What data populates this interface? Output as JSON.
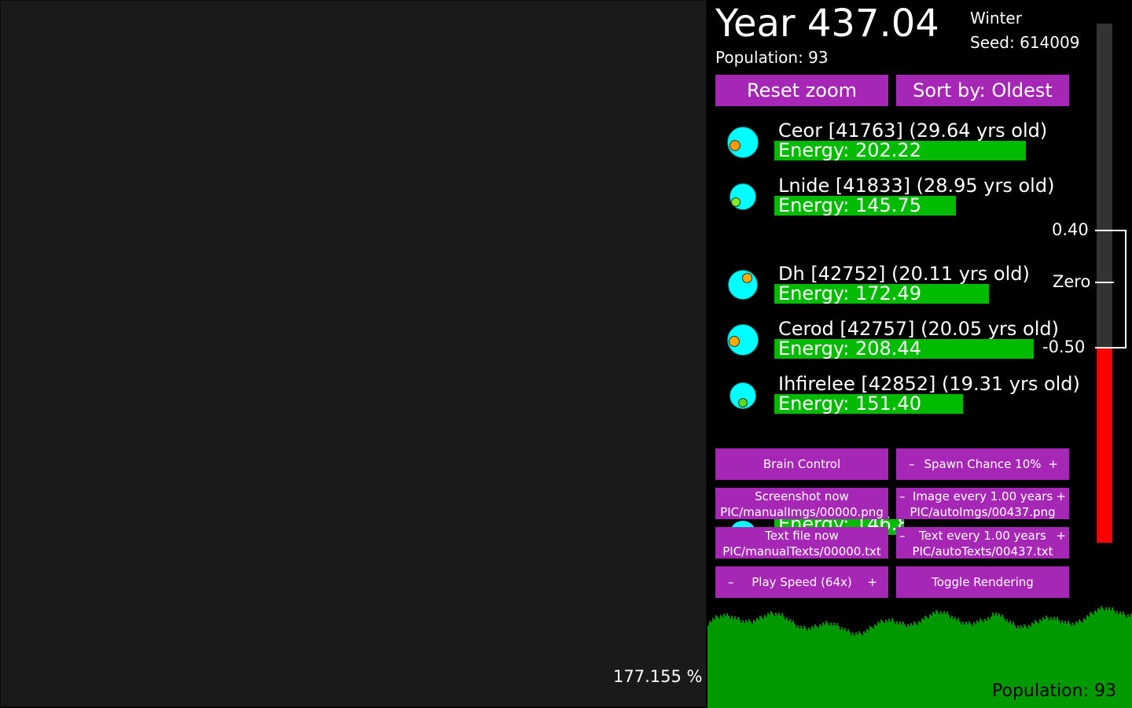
{
  "world": {
    "zoom_readout": "177.155 %"
  },
  "header": {
    "year": "Year 437.04",
    "population": "Population: 93",
    "season": "Winter",
    "seed": "Seed: 614009"
  },
  "buttons": {
    "reset_zoom": "Reset zoom",
    "sort_by": "Sort by: Oldest",
    "brain_control": "Brain Control",
    "spawn_chance": "Spawn Chance 10%",
    "screenshot_now": "Screenshot now",
    "screenshot_path": "PIC/manualImgs/00000.png",
    "image_every": "Image every 1.00 years",
    "image_path": "PIC/autoImgs/00437.png",
    "text_file_now": "Text file now",
    "text_file_path": "PIC/manualTexts/00000.txt",
    "text_every": "Text every 1.00 years",
    "text_path": "PIC/autoTexts/00437.txt",
    "play_speed": "Play Speed (64x)",
    "toggle_rendering": "Toggle Rendering",
    "minus": "–",
    "plus": "+"
  },
  "critters": [
    {
      "name": "Ceor [41763] (29.64 yrs old)",
      "energy_label": "Energy: 202.22",
      "energy": 202.22,
      "mouth_color": "#ff9900"
    },
    {
      "name": "Lnide [41833] (28.95 yrs old)",
      "energy_label": "Energy: 145.75",
      "energy": 145.75,
      "mouth_color": "#88ee22"
    },
    {
      "name": "Dh [42752] (20.11 yrs old)",
      "energy_label": "Energy: 172.49",
      "energy": 172.49,
      "mouth_color": "#ffaa00"
    },
    {
      "name": "Cerod [42757] (20.05 yrs old)",
      "energy_label": "Energy: 208.44",
      "energy": 208.44,
      "mouth_color": "#ffaa00"
    },
    {
      "name": "Ihfirelee [42852] (19.31 yrs old)",
      "energy_label": "Energy: 151.40",
      "energy": 151.4,
      "mouth_color": "#55dd22"
    }
  ],
  "hidden_row": {
    "text": "Energy: 146.80"
  },
  "scale": {
    "labels": {
      "upper": "0.40",
      "zero": "Zero",
      "lower": "-0.50"
    },
    "fill_color": "#ff0000",
    "track_color": "#333333"
  },
  "population_graph": {
    "label": "Population: 93",
    "color": "#009900"
  },
  "colors": {
    "button": "#a627b5",
    "energy": "#00bb00",
    "creature_body": "#00ffff"
  }
}
